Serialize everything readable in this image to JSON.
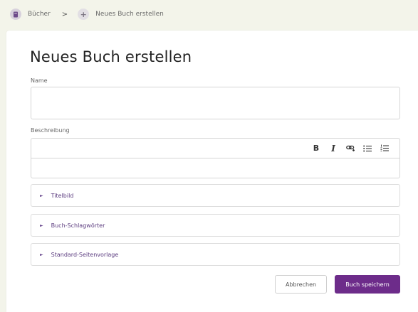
{
  "breadcrumb": {
    "items": [
      {
        "label": "Bücher",
        "icon": "book-icon"
      },
      {
        "label": "Neues Buch erstellen",
        "icon": "plus-icon"
      }
    ],
    "separator": ">"
  },
  "form": {
    "title": "Neues Buch erstellen",
    "name_label": "Name",
    "name_value": "",
    "description_label": "Beschreibung",
    "description_value": "",
    "toolbar": {
      "bold": "B",
      "italic": "I",
      "link_icon": "link-icon",
      "bullet_list_icon": "bullet-list-icon",
      "numbered_list_icon": "numbered-list-icon"
    },
    "sections": [
      {
        "label": "Titelbild"
      },
      {
        "label": "Buch-Schlagwörter"
      },
      {
        "label": "Standard-Seitenvorlage"
      }
    ],
    "cancel_label": "Abbrechen",
    "save_label": "Buch speichern"
  },
  "colors": {
    "background": "#f3f4ea",
    "accent": "#6d2c8a",
    "section_text": "#5a3a7e"
  }
}
